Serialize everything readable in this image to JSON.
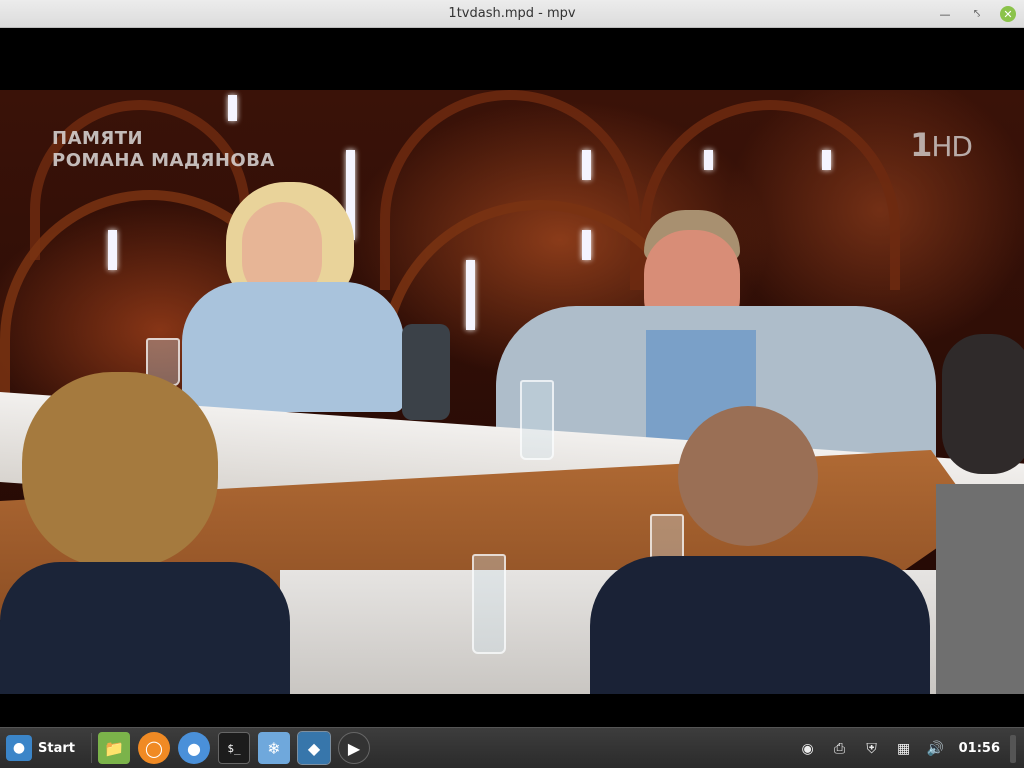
{
  "window": {
    "title": "1tvdash.mpd - mpv"
  },
  "video": {
    "caption_line1": "ПАМЯТИ",
    "caption_line2": "РОМАНА МАДЯНОВА",
    "channel_logo": "1",
    "channel_logo_suffix": "HD"
  },
  "taskbar": {
    "start_label": "Start",
    "launchers": [
      {
        "name": "file-manager-icon",
        "color": "#7bb34a"
      },
      {
        "name": "firefox-icon",
        "color": "#f08a24"
      },
      {
        "name": "chrome-icon",
        "color": "#4a90d9"
      },
      {
        "name": "terminal-icon",
        "color": "#222222"
      },
      {
        "name": "app-icon",
        "color": "#6fa8dc"
      },
      {
        "name": "python-icon",
        "color": "#3776ab"
      },
      {
        "name": "mpv-icon",
        "color": "#444444"
      }
    ],
    "clock": "01:56"
  },
  "colors": {
    "titlebar": "#e4e4e4",
    "taskbar": "#333333",
    "close_button": "#8bc34a"
  }
}
